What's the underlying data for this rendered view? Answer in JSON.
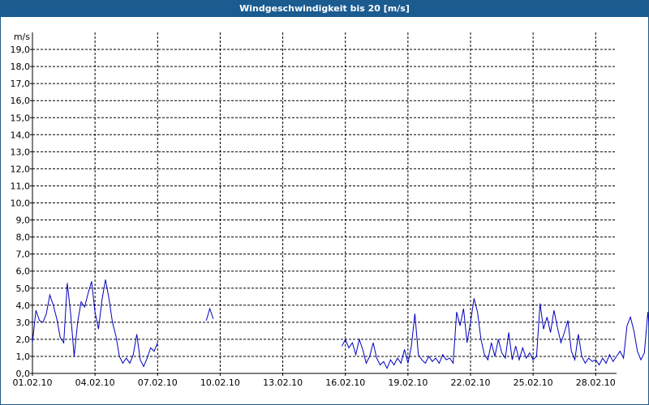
{
  "window": {
    "title": "Windgeschwindigkeit bis 20 [m/s]"
  },
  "chart_data": {
    "type": "line",
    "title": "Windgeschwindigkeit bis 20 [m/s]",
    "ylabel": "m/s",
    "ylim": [
      0,
      20
    ],
    "yticks": [
      "0,0",
      "1,0",
      "2,0",
      "3,0",
      "4,0",
      "5,0",
      "6,0",
      "7,0",
      "8,0",
      "9,0",
      "10,0",
      "11,0",
      "12,0",
      "13,0",
      "14,0",
      "15,0",
      "16,0",
      "17,0",
      "18,0",
      "19,0"
    ],
    "xlim": [
      "2010-02-01",
      "2010-03-01"
    ],
    "xticks": [
      "01.02.10",
      "04.02.10",
      "07.02.10",
      "10.02.10",
      "13.02.10",
      "16.02.10",
      "19.02.10",
      "22.02.10",
      "25.02.10",
      "28.02.10"
    ],
    "grid": true,
    "series": [
      {
        "color": "#0000c0",
        "segments": [
          [
            [
              "2010-02-01T00:00",
              1.8
            ],
            [
              "2010-02-01T04:00",
              3.7
            ],
            [
              "2010-02-01T08:00",
              3.1
            ],
            [
              "2010-02-01T12:00",
              3.0
            ],
            [
              "2010-02-01T16:00",
              3.5
            ],
            [
              "2010-02-01T20:00",
              4.6
            ],
            [
              "2010-02-02T00:00",
              4.0
            ],
            [
              "2010-02-02T04:00",
              3.2
            ],
            [
              "2010-02-02T08:00",
              2.1
            ],
            [
              "2010-02-02T12:00",
              1.8
            ],
            [
              "2010-02-02T16:00",
              5.3
            ],
            [
              "2010-02-02T20:00",
              3.5
            ],
            [
              "2010-02-03T00:00",
              1.0
            ],
            [
              "2010-02-03T04:00",
              3.0
            ],
            [
              "2010-02-03T08:00",
              4.2
            ],
            [
              "2010-02-03T12:00",
              3.9
            ],
            [
              "2010-02-03T16:00",
              4.7
            ],
            [
              "2010-02-03T20:00",
              5.4
            ],
            [
              "2010-02-04T00:00",
              3.6
            ],
            [
              "2010-02-04T04:00",
              2.6
            ],
            [
              "2010-02-04T08:00",
              4.3
            ],
            [
              "2010-02-04T12:00",
              5.5
            ],
            [
              "2010-02-04T16:00",
              4.4
            ],
            [
              "2010-02-04T20:00",
              3.0
            ],
            [
              "2010-02-05T00:00",
              2.2
            ],
            [
              "2010-02-05T04:00",
              1.0
            ],
            [
              "2010-02-05T08:00",
              0.6
            ],
            [
              "2010-02-05T12:00",
              0.9
            ],
            [
              "2010-02-05T16:00",
              0.6
            ],
            [
              "2010-02-05T20:00",
              1.1
            ],
            [
              "2010-02-06T00:00",
              2.3
            ],
            [
              "2010-02-06T04:00",
              0.8
            ],
            [
              "2010-02-06T08:00",
              0.4
            ],
            [
              "2010-02-06T12:00",
              0.9
            ],
            [
              "2010-02-06T16:00",
              1.5
            ],
            [
              "2010-02-06T20:00",
              1.3
            ],
            [
              "2010-02-07T00:00",
              1.8
            ]
          ],
          [
            [
              "2010-02-09T08:00",
              3.1
            ],
            [
              "2010-02-09T12:00",
              3.8
            ],
            [
              "2010-02-09T16:00",
              3.2
            ]
          ],
          [
            [
              "2010-02-15T20:00",
              1.6
            ],
            [
              "2010-02-16T00:00",
              2.0
            ],
            [
              "2010-02-16T04:00",
              1.5
            ],
            [
              "2010-02-16T08:00",
              1.8
            ],
            [
              "2010-02-16T12:00",
              1.1
            ],
            [
              "2010-02-16T16:00",
              2.0
            ],
            [
              "2010-02-16T20:00",
              1.4
            ],
            [
              "2010-02-17T00:00",
              0.6
            ],
            [
              "2010-02-17T04:00",
              1.0
            ],
            [
              "2010-02-17T08:00",
              1.8
            ],
            [
              "2010-02-17T12:00",
              0.9
            ],
            [
              "2010-02-17T16:00",
              0.5
            ],
            [
              "2010-02-17T20:00",
              0.7
            ],
            [
              "2010-02-18T00:00",
              0.3
            ],
            [
              "2010-02-18T04:00",
              0.8
            ],
            [
              "2010-02-18T08:00",
              0.5
            ],
            [
              "2010-02-18T12:00",
              0.9
            ],
            [
              "2010-02-18T16:00",
              0.6
            ],
            [
              "2010-02-18T20:00",
              1.4
            ],
            [
              "2010-02-19T00:00",
              0.6
            ],
            [
              "2010-02-19T04:00",
              1.6
            ],
            [
              "2010-02-19T08:00",
              3.5
            ],
            [
              "2010-02-19T12:00",
              1.1
            ],
            [
              "2010-02-19T16:00",
              0.8
            ],
            [
              "2010-02-19T20:00",
              0.6
            ],
            [
              "2010-02-20T00:00",
              1.0
            ],
            [
              "2010-02-20T04:00",
              0.7
            ],
            [
              "2010-02-20T08:00",
              0.9
            ],
            [
              "2010-02-20T12:00",
              0.6
            ],
            [
              "2010-02-20T16:00",
              1.1
            ],
            [
              "2010-02-20T20:00",
              0.8
            ],
            [
              "2010-02-21T00:00",
              0.9
            ],
            [
              "2010-02-21T04:00",
              0.6
            ],
            [
              "2010-02-21T08:00",
              3.6
            ],
            [
              "2010-02-21T12:00",
              2.8
            ],
            [
              "2010-02-21T16:00",
              3.8
            ],
            [
              "2010-02-21T20:00",
              1.8
            ],
            [
              "2010-02-22T00:00",
              3.0
            ],
            [
              "2010-02-22T04:00",
              4.4
            ],
            [
              "2010-02-22T08:00",
              3.6
            ],
            [
              "2010-02-22T12:00",
              2.0
            ],
            [
              "2010-02-22T16:00",
              1.1
            ],
            [
              "2010-02-22T20:00",
              0.8
            ],
            [
              "2010-02-23T00:00",
              1.8
            ],
            [
              "2010-02-23T04:00",
              1.0
            ],
            [
              "2010-02-23T08:00",
              2.0
            ],
            [
              "2010-02-23T12:00",
              1.2
            ],
            [
              "2010-02-23T16:00",
              0.9
            ],
            [
              "2010-02-23T20:00",
              2.4
            ],
            [
              "2010-02-24T00:00",
              0.8
            ],
            [
              "2010-02-24T04:00",
              1.6
            ],
            [
              "2010-02-24T08:00",
              0.8
            ],
            [
              "2010-02-24T12:00",
              1.5
            ],
            [
              "2010-02-24T16:00",
              0.9
            ],
            [
              "2010-02-24T20:00",
              1.2
            ],
            [
              "2010-02-25T00:00",
              0.8
            ],
            [
              "2010-02-25T04:00",
              1.0
            ],
            [
              "2010-02-25T08:00",
              4.1
            ],
            [
              "2010-02-25T12:00",
              2.6
            ],
            [
              "2010-02-25T16:00",
              3.3
            ],
            [
              "2010-02-25T20:00",
              2.4
            ],
            [
              "2010-02-26T00:00",
              3.7
            ],
            [
              "2010-02-26T04:00",
              2.7
            ],
            [
              "2010-02-26T08:00",
              1.8
            ],
            [
              "2010-02-26T12:00",
              2.4
            ],
            [
              "2010-02-26T16:00",
              3.1
            ],
            [
              "2010-02-26T20:00",
              1.3
            ],
            [
              "2010-02-27T00:00",
              0.8
            ],
            [
              "2010-02-27T04:00",
              2.3
            ],
            [
              "2010-02-27T08:00",
              1.0
            ],
            [
              "2010-02-27T12:00",
              0.6
            ],
            [
              "2010-02-27T16:00",
              0.9
            ],
            [
              "2010-02-27T20:00",
              0.7
            ],
            [
              "2010-02-28T00:00",
              0.8
            ],
            [
              "2010-02-28T04:00",
              0.5
            ],
            [
              "2010-02-28T08:00",
              0.9
            ],
            [
              "2010-02-28T12:00",
              0.6
            ],
            [
              "2010-02-28T16:00",
              1.1
            ],
            [
              "2010-02-28T20:00",
              0.7
            ],
            [
              "2010-03-01T00:00",
              1.0
            ],
            [
              "2010-03-01T04:00",
              1.3
            ],
            [
              "2010-03-01T08:00",
              0.9
            ],
            [
              "2010-03-01T12:00",
              2.8
            ],
            [
              "2010-03-01T16:00",
              3.3
            ],
            [
              "2010-03-01T20:00",
              2.5
            ],
            [
              "2010-03-02T00:00",
              1.3
            ],
            [
              "2010-03-02T04:00",
              0.8
            ],
            [
              "2010-03-02T08:00",
              1.2
            ],
            [
              "2010-03-02T12:00",
              3.6
            ],
            [
              "2010-03-02T16:00",
              1.4
            ]
          ]
        ]
      }
    ]
  }
}
